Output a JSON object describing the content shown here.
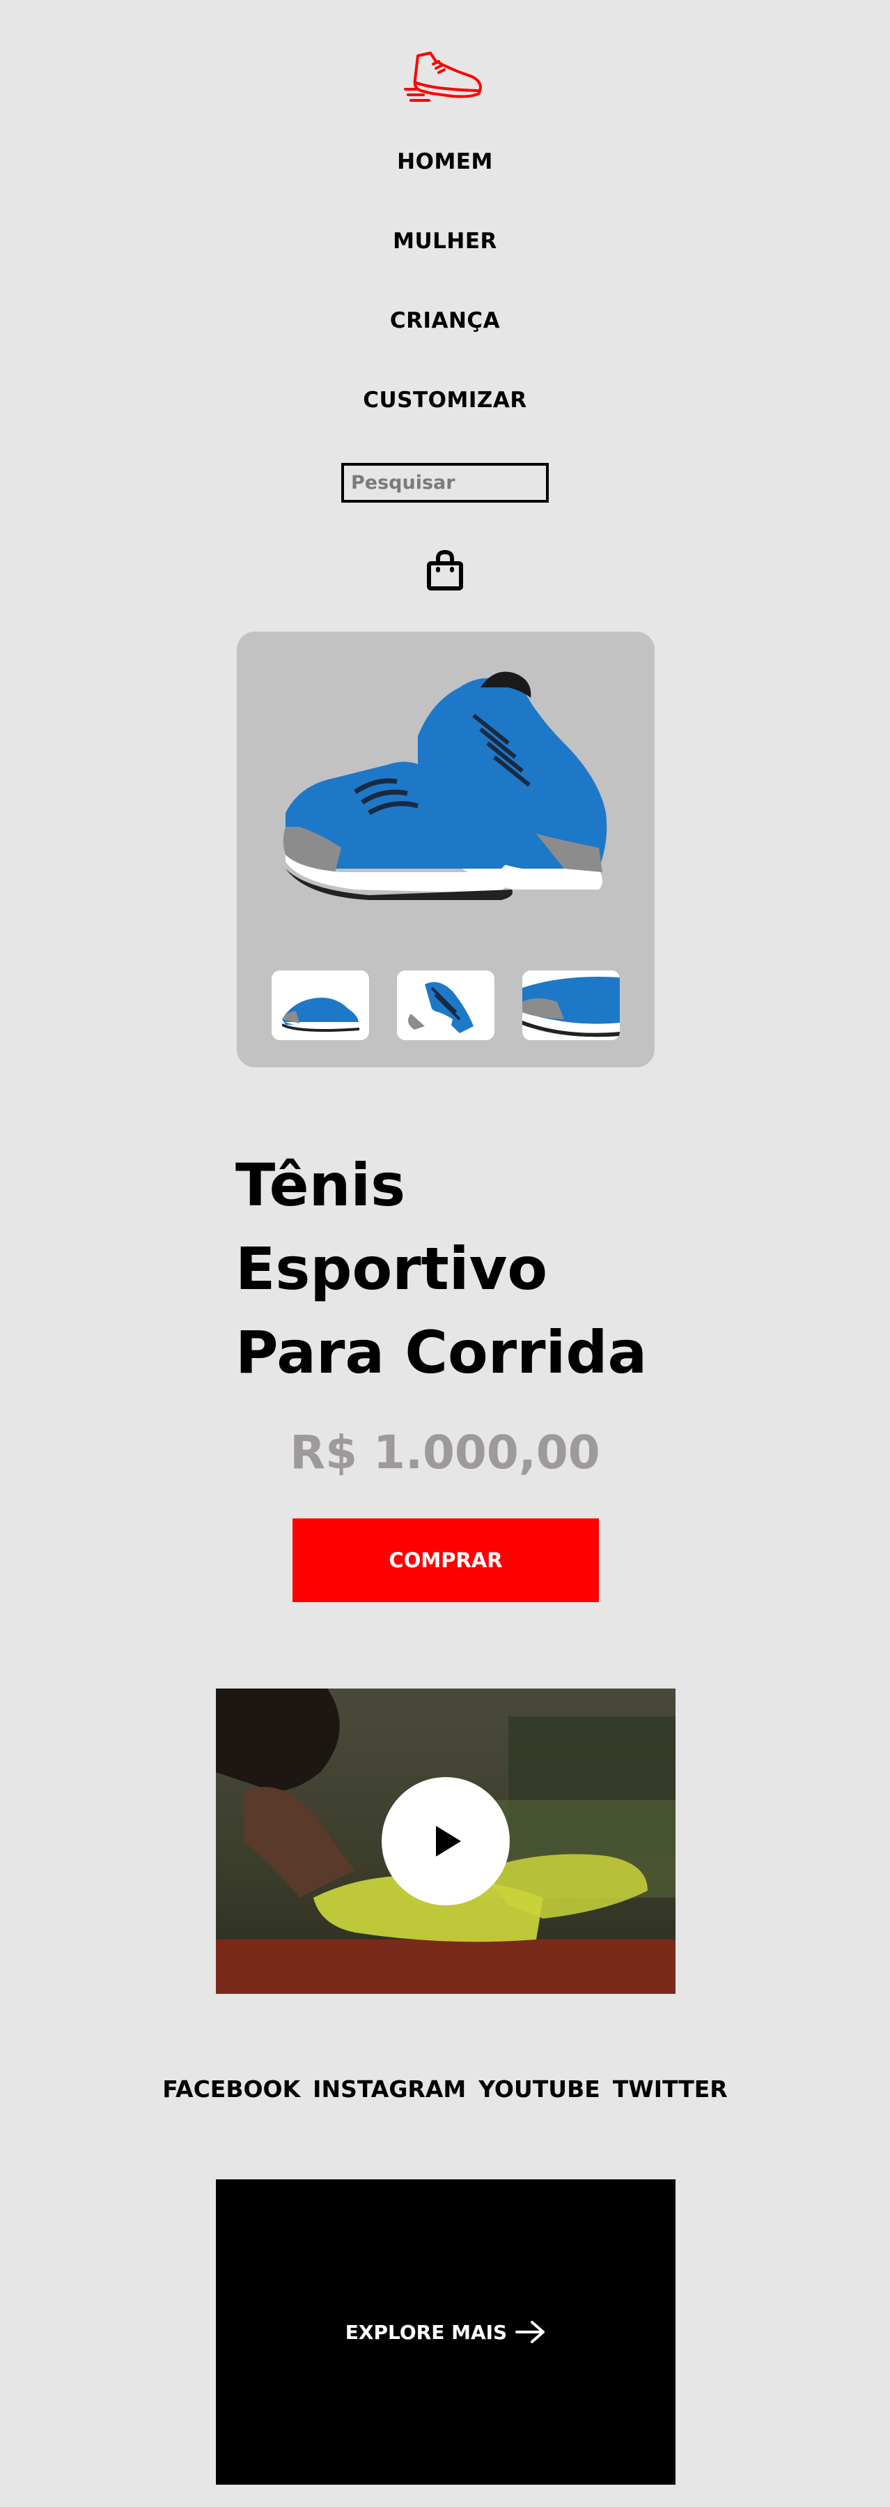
{
  "header": {
    "logo_icon": "running-shoe-icon",
    "logo_color": "#ff0000"
  },
  "nav": {
    "items": [
      {
        "label": "HOMEM"
      },
      {
        "label": "MULHER"
      },
      {
        "label": "CRIANÇA"
      },
      {
        "label": "CUSTOMIZAR"
      }
    ]
  },
  "search": {
    "placeholder": "Pesquisar",
    "value": ""
  },
  "cart": {
    "icon": "shopping-bag-icon"
  },
  "product": {
    "title": "Tênis Esportivo Para Corrida",
    "price": "R$ 1.000,00",
    "buy_label": "COMPRAR",
    "accent": "#ff0000",
    "price_color": "#9e9a9b",
    "shoe_color": "#1e78c8"
  },
  "video": {
    "icon": "play-icon"
  },
  "social": {
    "links": [
      {
        "label": "FACEBOOK"
      },
      {
        "label": "INSTAGRAM"
      },
      {
        "label": "YOUTUBE"
      },
      {
        "label": "TWITTER"
      }
    ]
  },
  "explore": {
    "label": "EXPLORE MAIS",
    "icon": "arrow-right-icon"
  }
}
